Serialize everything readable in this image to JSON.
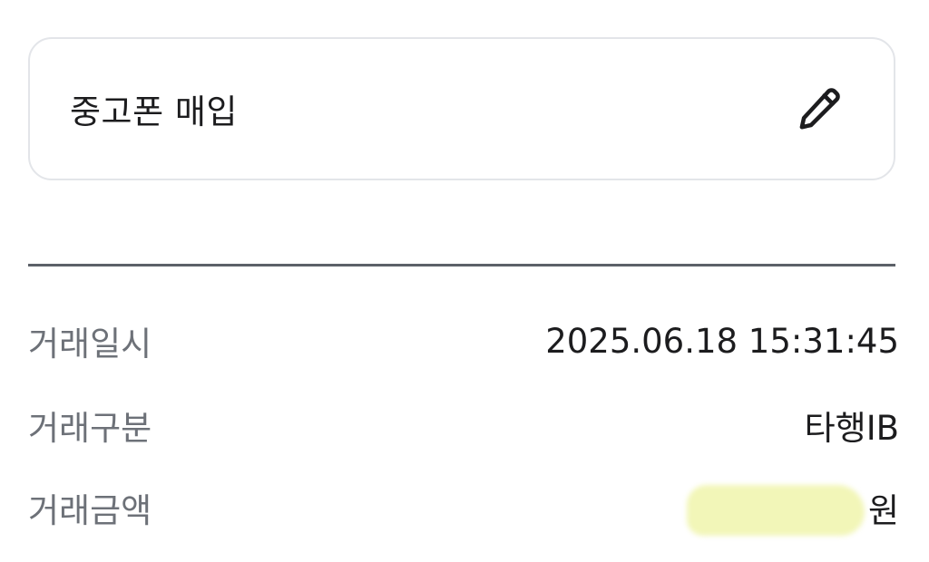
{
  "memo": {
    "text": "중고폰 매입",
    "edit_icon": "pencil-icon"
  },
  "details": {
    "datetime": {
      "label": "거래일시",
      "value": "2025.06.18 15:31:45"
    },
    "type": {
      "label": "거래구분",
      "value": "타행IB"
    },
    "amount": {
      "label": "거래금액",
      "unit": "원"
    }
  },
  "colors": {
    "redaction": "#f2f6b8",
    "divider": "#5c6168",
    "label": "#6d7178",
    "text": "#1c1c1e"
  }
}
